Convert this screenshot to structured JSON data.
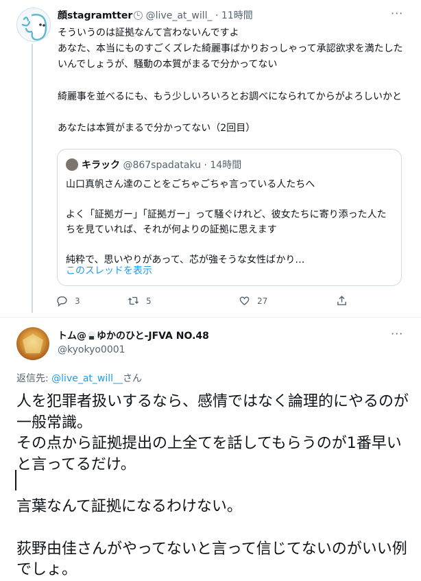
{
  "tweet1": {
    "author_name": "顔stagramtter",
    "handle": "@live_at_will_",
    "separator": "·",
    "time": "11時間",
    "more": "···",
    "paragraphs": [
      "そういうのは証拠なんて言わないんですよ\nあなた、本当にものすごくズレた綺麗事ばかりおっしゃって承認欲求を満たしたいんでしょうが、騒動の本質がまるで分かってない",
      "綺麗事を並べるにも、もう少しいろいろとお調べになられてからがよろしいかと",
      "あなたは本質がまるで分かってない（2回目）"
    ],
    "quote": {
      "author_name": "キラック",
      "handle": "@867spadataku",
      "separator": "·",
      "time": "14時間",
      "paragraphs": [
        "山口真帆さん達のことをごちゃごちゃ言っている人たちへ",
        "よく「証拠ガー」「証拠ガー」って騒ぐけれど、彼女たちに寄り添った人たちを見ていれば、それが何よりの証拠に思えます",
        "純粋で、思いやりがあって、芯が強そうな女性ばかり…"
      ],
      "show_thread": "このスレッドを表示"
    },
    "actions": {
      "replies": "3",
      "retweets": "5",
      "likes": "27"
    }
  },
  "tweet2": {
    "author_name_pre": "トム@",
    "author_name_post": "ゆかのひと-JFVA NO.48",
    "handle": "@kyokyo0001",
    "more": "···",
    "reply_prefix": "返信先: ",
    "reply_to": "@live_at_will__",
    "reply_suffix": "さん",
    "paragraphs": [
      "人を犯罪者扱いするなら、感情ではなく論理的にやるのが一般常識。\nその点から証拠提出の上全てを話してもらうのが1番早いと言ってるだけ。",
      "言葉なんて証拠になるわけない。",
      "荻野由佳さんがやってないと言って信じてないのがいい例でしょ。"
    ]
  },
  "colors": {
    "text": "#0f1419",
    "secondary": "#536471",
    "link": "#1d9bf0",
    "border": "#cfd9de"
  }
}
